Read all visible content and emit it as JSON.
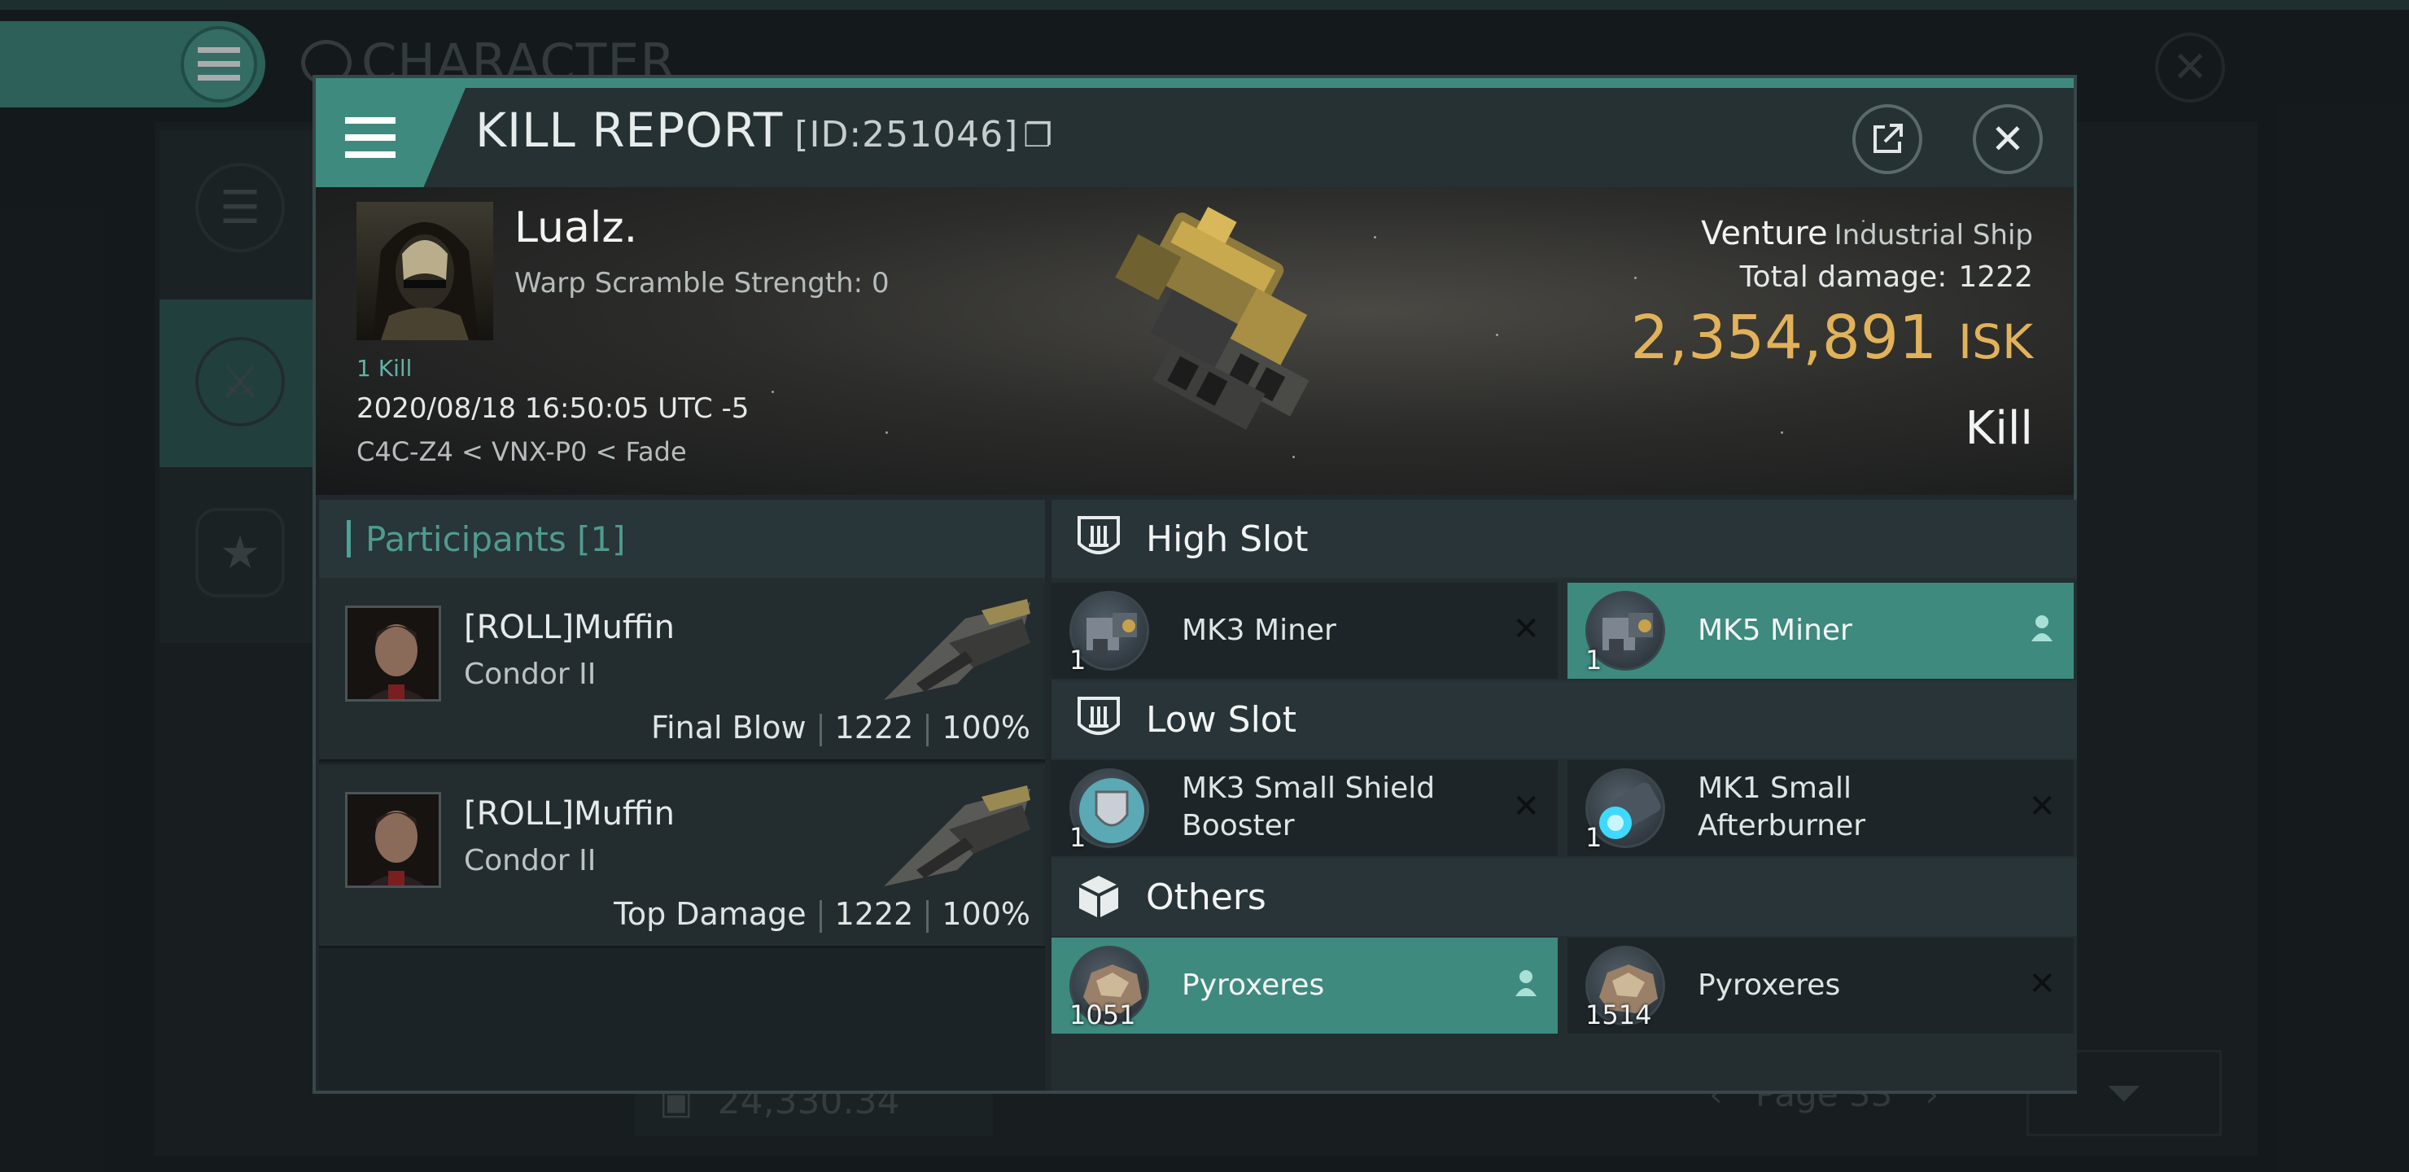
{
  "background": {
    "menu_icon": "hamburger-icon",
    "title": "CHARACTER",
    "isk_value": "24,330.34",
    "page_label": "Page 33"
  },
  "header": {
    "title": "KILL REPORT",
    "id": "[ID:251046]",
    "copy_icon": "copy-icon",
    "share_icon": "external-link-icon",
    "close_icon": "close-icon"
  },
  "victim": {
    "name": "Lualz.",
    "warp_scramble": "Warp Scramble Strength: 0",
    "kill_count": "1 Kill",
    "datetime": "2020/08/18 16:50:05 UTC -5",
    "location": "C4C-Z4 < VNX-P0 < Fade",
    "ship_name": "Venture",
    "ship_class": "Industrial Ship",
    "total_damage_label": "Total damage:",
    "total_damage": "1222",
    "isk_value": "2,354,891",
    "isk_unit": "ISK",
    "result": "Kill"
  },
  "participants": {
    "header": "Participants [1]",
    "rows": [
      {
        "name": "[ROLL]Muffin",
        "ship": "Condor II",
        "role": "Final Blow",
        "damage": "1222",
        "percent": "100%"
      },
      {
        "name": "[ROLL]Muffin",
        "ship": "Condor II",
        "role": "Top Damage",
        "damage": "1222",
        "percent": "100%"
      }
    ]
  },
  "slots": {
    "high": {
      "label": "High Slot",
      "items": [
        {
          "name": "MK3 Miner",
          "qty": "1",
          "status": "destroyed"
        },
        {
          "name": "MK5 Miner",
          "qty": "1",
          "status": "dropped"
        }
      ]
    },
    "low": {
      "label": "Low Slot",
      "items": [
        {
          "name": "MK3 Small Shield Booster",
          "qty": "1",
          "status": "destroyed"
        },
        {
          "name": "MK1 Small Afterburner",
          "qty": "1",
          "status": "destroyed"
        }
      ]
    },
    "others": {
      "label": "Others",
      "items": [
        {
          "name": "Pyroxeres",
          "qty": "1051",
          "status": "dropped"
        },
        {
          "name": "Pyroxeres",
          "qty": "1514",
          "status": "destroyed"
        }
      ]
    },
    "destroyed_mark": "✕"
  },
  "colors": {
    "accent": "#3e8a7f",
    "isk": "#e2b25a",
    "panel": "#20282b"
  }
}
